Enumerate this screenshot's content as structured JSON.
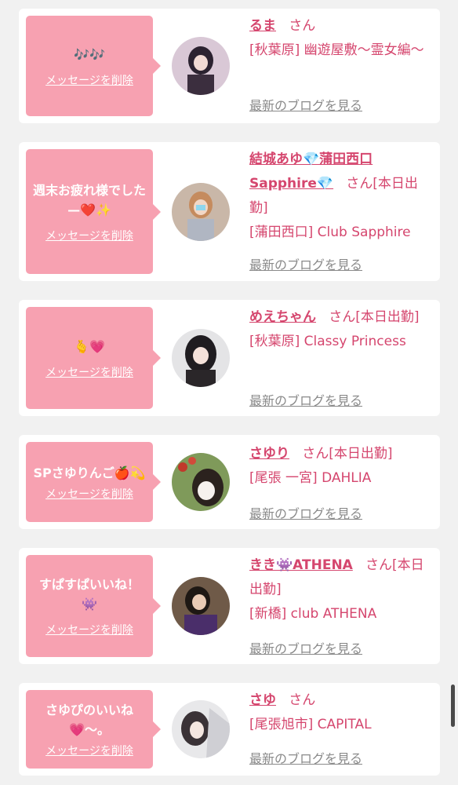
{
  "delete_label": "メッセージを削除",
  "blog_label": "最新のブログを見る",
  "san": "さん",
  "entries": [
    {
      "message": "🎶🎶",
      "name": "るま",
      "san_suffix": "",
      "shop": "[秋葉原] 幽遊屋敷〜霊女編〜"
    },
    {
      "message": "週末お疲れ様でした—❤️✨",
      "name": "結城あゆ💎蒲田西口Sapphire💎",
      "san_suffix": "[本日出勤]",
      "shop": "[蒲田西口] Club Sapphire"
    },
    {
      "message": "🫰💗",
      "name": "めえちゃん",
      "san_suffix": "[本日出勤]",
      "shop": "[秋葉原] Classy Princess"
    },
    {
      "message": "SPさゆりんご🍎💫",
      "name": "さゆり",
      "san_suffix": "[本日出勤]",
      "shop": "[尾張 一宮] DAHLIA"
    },
    {
      "message": "すぱすぱいいね！👾",
      "name": "きき👾ATHENA",
      "san_suffix": "[本日出勤]",
      "shop": "[新橋] club ATHENA"
    },
    {
      "message": "さゆぴのいいね💗〜。",
      "name": "さゆ",
      "san_suffix": "",
      "shop": "[尾張旭市] CAPITAL"
    }
  ]
}
